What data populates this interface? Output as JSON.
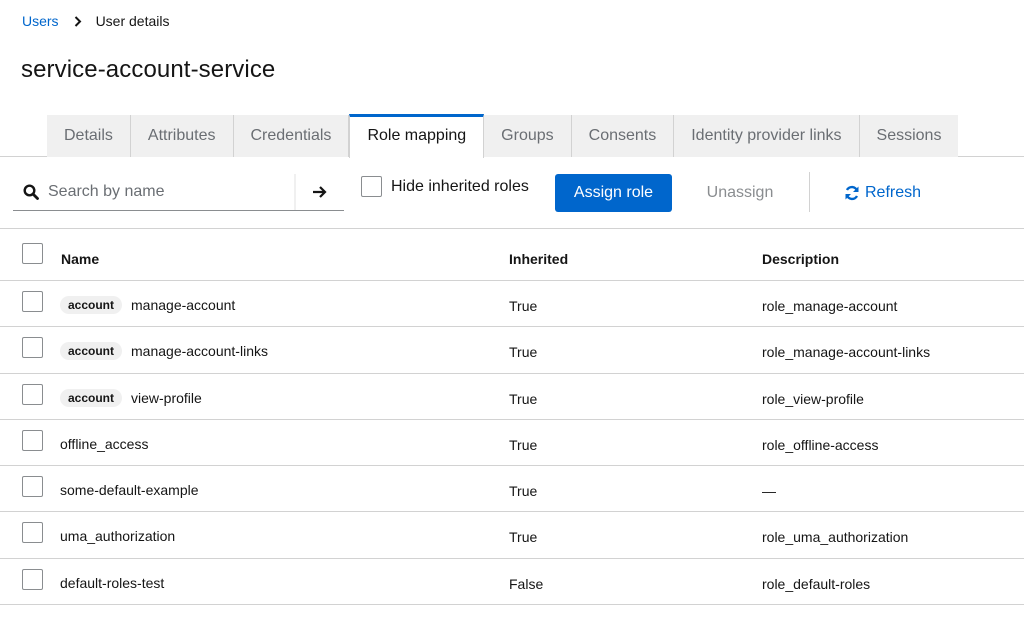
{
  "breadcrumb": {
    "parent": "Users",
    "current": "User details"
  },
  "page": {
    "title": "service-account-service"
  },
  "tabs": [
    {
      "label": "Details",
      "active": false
    },
    {
      "label": "Attributes",
      "active": false
    },
    {
      "label": "Credentials",
      "active": false
    },
    {
      "label": "Role mapping",
      "active": true
    },
    {
      "label": "Groups",
      "active": false
    },
    {
      "label": "Consents",
      "active": false
    },
    {
      "label": "Identity provider links",
      "active": false
    },
    {
      "label": "Sessions",
      "active": false
    }
  ],
  "toolbar": {
    "search_placeholder": "Search by name",
    "hide_inherited_label": "Hide inherited roles",
    "hide_inherited_checked": false,
    "assign_label": "Assign role",
    "unassign_label": "Unassign",
    "refresh_label": "Refresh"
  },
  "table": {
    "headers": {
      "name": "Name",
      "inherited": "Inherited",
      "description": "Description"
    },
    "rows": [
      {
        "client": "account",
        "name": "manage-account",
        "inherited": "True",
        "description": "role_manage-account"
      },
      {
        "client": "account",
        "name": "manage-account-links",
        "inherited": "True",
        "description": "role_manage-account-links"
      },
      {
        "client": "account",
        "name": "view-profile",
        "inherited": "True",
        "description": "role_view-profile"
      },
      {
        "client": "",
        "name": "offline_access",
        "inherited": "True",
        "description": "role_offline-access"
      },
      {
        "client": "",
        "name": "some-default-example",
        "inherited": "True",
        "description": "—"
      },
      {
        "client": "",
        "name": "uma_authorization",
        "inherited": "True",
        "description": "role_uma_authorization"
      },
      {
        "client": "",
        "name": "default-roles-test",
        "inherited": "False",
        "description": "role_default-roles"
      }
    ]
  },
  "colors": {
    "accent": "#0066cc",
    "tab_inactive_bg": "#f0f0f0",
    "border": "#d2d2d2",
    "muted_text": "#6a6e73"
  },
  "icons": {
    "breadcrumb_sep": "chevron-right-icon",
    "search": "search-icon",
    "submit": "arrow-right-icon",
    "refresh": "refresh-icon"
  }
}
